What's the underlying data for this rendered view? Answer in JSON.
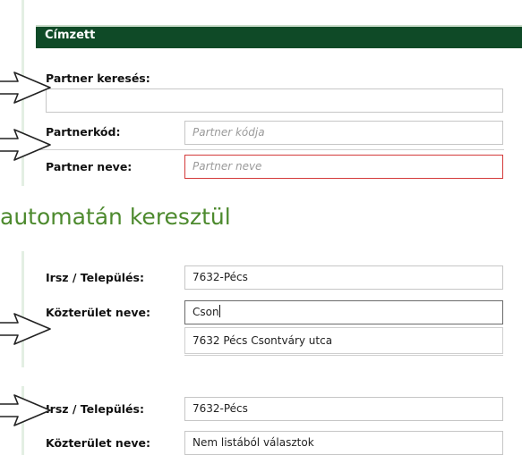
{
  "recipient_panel": {
    "title": "Címzett",
    "partner_search_label": "Partner keresés:",
    "partner_search_value": "",
    "partner_code_label": "Partnerkód:",
    "partner_code_placeholder": "Partner kódja",
    "partner_name_label": "Partner neve:",
    "partner_name_placeholder": "Partner neve"
  },
  "section_heading": "automatán keresztül",
  "address_autocomplete": {
    "settlement_label": "Irsz / Település:",
    "settlement_value": "7632-Pécs",
    "street_label": "Közterület neve:",
    "street_value": "Cson",
    "suggestion": "7632 Pécs Csontváry utca"
  },
  "address_manual": {
    "settlement_label": "Irsz / Település:",
    "settlement_value": "7632-Pécs",
    "street_label": "Közterület neve:",
    "street_value": "Nem listából választok"
  },
  "colors": {
    "header_bg": "#0f4a27",
    "heading_text": "#4d8a2e",
    "error_border": "#d43a3a"
  },
  "icons": {
    "pointer": "outline-arrow-icon"
  }
}
